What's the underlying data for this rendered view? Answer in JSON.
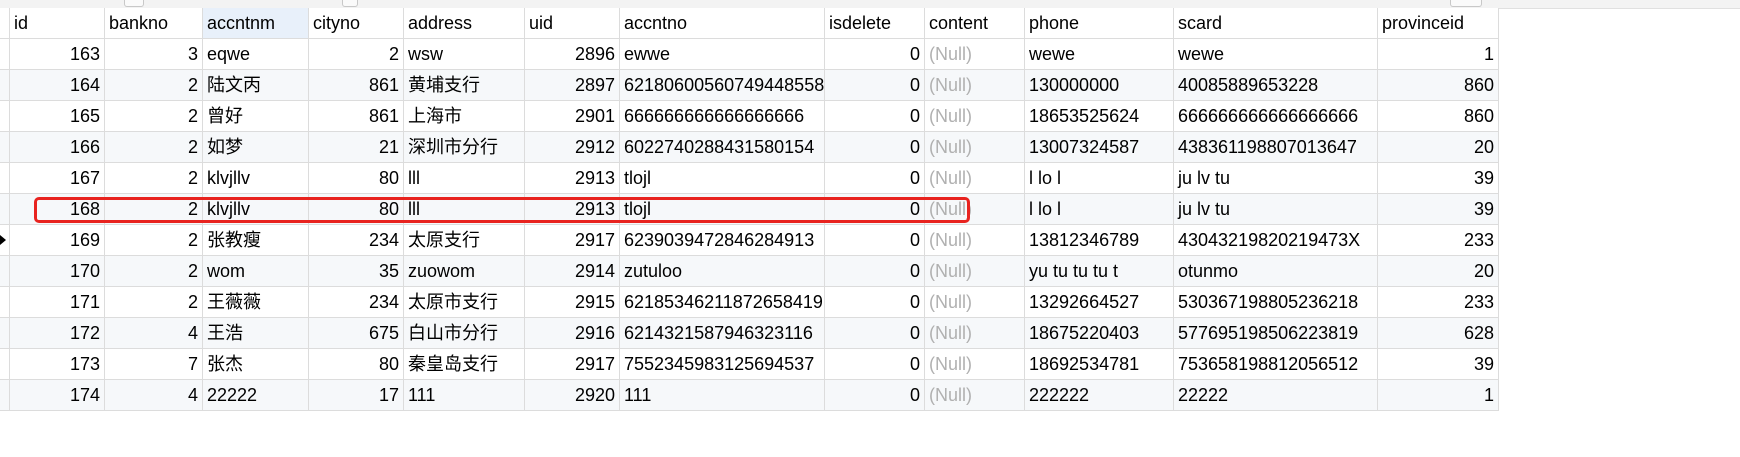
{
  "columns": [
    "id",
    "bankno",
    "accntnm",
    "cityno",
    "address",
    "uid",
    "accntno",
    "isdelete",
    "content",
    "phone",
    "scard",
    "provinceid"
  ],
  "rows": [
    {
      "id": "163",
      "bankno": "3",
      "accntnm": "eqwe",
      "cityno": "2",
      "address": "wsw",
      "uid": "2896",
      "accntno": "ewwe",
      "isdelete": "0",
      "content": "(Null)",
      "phone": "wewe",
      "scard": "wewe",
      "provinceid": "1"
    },
    {
      "id": "164",
      "bankno": "2",
      "accntnm": "陆文丙",
      "cityno": "861",
      "address": "黄埔支行",
      "uid": "2897",
      "accntno": "62180600560749448558",
      "isdelete": "0",
      "content": "(Null)",
      "phone": "130000000",
      "scard": "40085889653228",
      "provinceid": "860"
    },
    {
      "id": "165",
      "bankno": "2",
      "accntnm": "曾好",
      "cityno": "861",
      "address": "上海市",
      "uid": "2901",
      "accntno": "666666666666666666",
      "isdelete": "0",
      "content": "(Null)",
      "phone": "18653525624",
      "scard": "666666666666666666",
      "provinceid": "860"
    },
    {
      "id": "166",
      "bankno": "2",
      "accntnm": "如梦",
      "cityno": "21",
      "address": "深圳市分行",
      "uid": "2912",
      "accntno": "6022740288431580154",
      "isdelete": "0",
      "content": "(Null)",
      "phone": "13007324587",
      "scard": "438361198807013647",
      "provinceid": "20"
    },
    {
      "id": "167",
      "bankno": "2",
      "accntnm": "klvjllv",
      "cityno": "80",
      "address": "lll",
      "uid": "2913",
      "accntno": "tlojl",
      "isdelete": "0",
      "content": "(Null)",
      "phone": "l lo l",
      "scard": "ju lv tu",
      "provinceid": "39"
    },
    {
      "id": "168",
      "bankno": "2",
      "accntnm": "klvjllv",
      "cityno": "80",
      "address": "lll",
      "uid": "2913",
      "accntno": "tlojl",
      "isdelete": "0",
      "content": "(Null)",
      "phone": "l lo l",
      "scard": "ju lv tu",
      "provinceid": "39"
    },
    {
      "id": "169",
      "bankno": "2",
      "accntnm": "张教瘦",
      "cityno": "234",
      "address": "太原支行",
      "uid": "2917",
      "accntno": "6239039472846284913",
      "isdelete": "0",
      "content": "(Null)",
      "phone": "13812346789",
      "scard": "43043219820219473X",
      "provinceid": "233"
    },
    {
      "id": "170",
      "bankno": "2",
      "accntnm": "wom",
      "cityno": "35",
      "address": "zuowom",
      "uid": "2914",
      "accntno": "zutuloo",
      "isdelete": "0",
      "content": "(Null)",
      "phone": "yu tu tu tu t",
      "scard": "otunmo",
      "provinceid": "20"
    },
    {
      "id": "171",
      "bankno": "2",
      "accntnm": "王薇薇",
      "cityno": "234",
      "address": "太原市支行",
      "uid": "2915",
      "accntno": "6218534621187265841​9",
      "isdelete": "0",
      "content": "(Null)",
      "phone": "13292664527",
      "scard": "530367198805236218",
      "provinceid": "233"
    },
    {
      "id": "172",
      "bankno": "4",
      "accntnm": "王浩",
      "cityno": "675",
      "address": "白山市分行",
      "uid": "2916",
      "accntno": "6214321587946323116",
      "isdelete": "0",
      "content": "(Null)",
      "phone": "18675220403",
      "scard": "577695198506223819",
      "provinceid": "628"
    },
    {
      "id": "173",
      "bankno": "7",
      "accntnm": "张杰",
      "cityno": "80",
      "address": "秦皇岛支行",
      "uid": "2917",
      "accntno": "7552345983125694537",
      "isdelete": "0",
      "content": "(Null)",
      "phone": "18692534781",
      "scard": "753658198812056512",
      "provinceid": "39"
    },
    {
      "id": "174",
      "bankno": "4",
      "accntnm": "22222",
      "cityno": "17",
      "address": "111",
      "uid": "2920",
      "accntno": "111",
      "isdelete": "0",
      "content": "(Null)",
      "phone": "222222",
      "scard": "22222",
      "provinceid": "1"
    }
  ],
  "current_row_index": 6,
  "colors": {
    "highlight_border": "#e8231f",
    "null_text": "#b0b0b0",
    "alt_row": "#f6f8fa",
    "sorted_header": "#e8f0fa"
  }
}
